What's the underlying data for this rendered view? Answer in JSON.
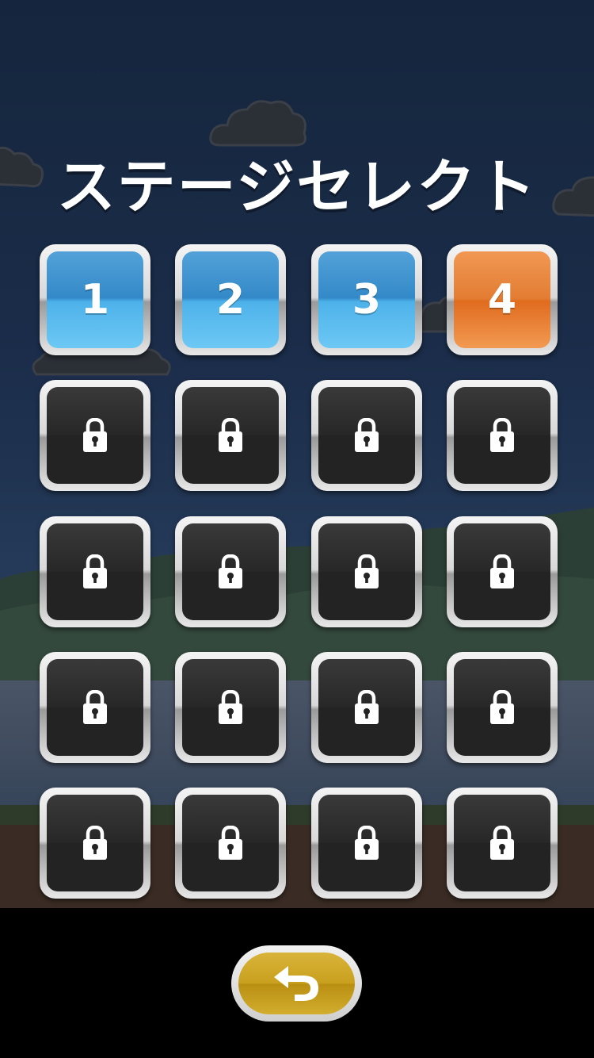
{
  "screen": {
    "title": "ステージセレクト"
  },
  "stages": [
    {
      "label": "1",
      "state": "cleared"
    },
    {
      "label": "2",
      "state": "cleared"
    },
    {
      "label": "3",
      "state": "cleared"
    },
    {
      "label": "4",
      "state": "current"
    },
    {
      "label": "",
      "state": "locked",
      "icon": "lock-icon"
    },
    {
      "label": "",
      "state": "locked",
      "icon": "lock-icon"
    },
    {
      "label": "",
      "state": "locked",
      "icon": "lock-icon"
    },
    {
      "label": "",
      "state": "locked",
      "icon": "lock-icon"
    },
    {
      "label": "",
      "state": "locked",
      "icon": "lock-icon"
    },
    {
      "label": "",
      "state": "locked",
      "icon": "lock-icon"
    },
    {
      "label": "",
      "state": "locked",
      "icon": "lock-icon"
    },
    {
      "label": "",
      "state": "locked",
      "icon": "lock-icon"
    },
    {
      "label": "",
      "state": "locked",
      "icon": "lock-icon"
    },
    {
      "label": "",
      "state": "locked",
      "icon": "lock-icon"
    },
    {
      "label": "",
      "state": "locked",
      "icon": "lock-icon"
    },
    {
      "label": "",
      "state": "locked",
      "icon": "lock-icon"
    },
    {
      "label": "",
      "state": "locked",
      "icon": "lock-icon"
    },
    {
      "label": "",
      "state": "locked",
      "icon": "lock-icon"
    },
    {
      "label": "",
      "state": "locked",
      "icon": "lock-icon"
    },
    {
      "label": "",
      "state": "locked",
      "icon": "lock-icon"
    }
  ],
  "back_button": {
    "icon": "return-arrow-icon"
  },
  "colors": {
    "cleared_tile": "#2e86c6",
    "current_tile": "#e27a2e",
    "locked_tile": "#232323",
    "back_button": "#c9a01e"
  }
}
